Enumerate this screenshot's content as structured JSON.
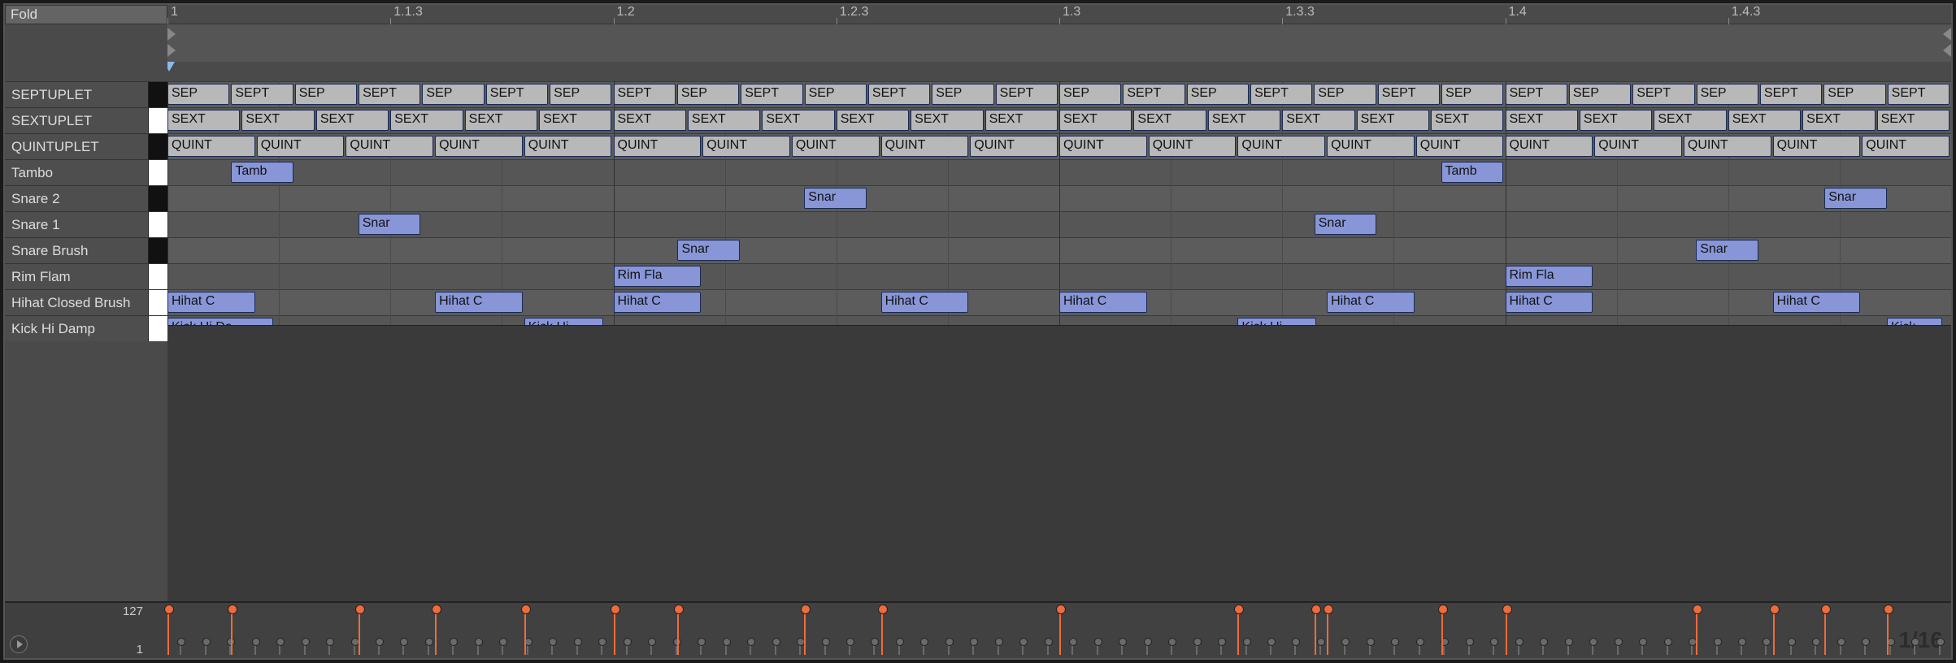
{
  "header": {
    "fold_label": "Fold"
  },
  "ruler": {
    "ticks": [
      {
        "pos": 0.0,
        "label": "1"
      },
      {
        "pos": 0.125,
        "label": "1.1.3"
      },
      {
        "pos": 0.25,
        "label": "1.2"
      },
      {
        "pos": 0.375,
        "label": "1.2.3"
      },
      {
        "pos": 0.5,
        "label": "1.3"
      },
      {
        "pos": 0.625,
        "label": "1.3.3"
      },
      {
        "pos": 0.75,
        "label": "1.4"
      },
      {
        "pos": 0.875,
        "label": "1.4.3"
      }
    ]
  },
  "playhead": {
    "pos": 0.001
  },
  "tracks": [
    {
      "name": "SEPTUPLET",
      "key": "black"
    },
    {
      "name": "SEXTUPLET",
      "key": "white"
    },
    {
      "name": "QUINTUPLET",
      "key": "black"
    },
    {
      "name": "Tambo",
      "key": "white"
    },
    {
      "name": "Snare 2",
      "key": "black"
    },
    {
      "name": "Snare 1",
      "key": "white"
    },
    {
      "name": "Snare Brush",
      "key": "black"
    },
    {
      "name": "Rim Flam",
      "key": "white"
    },
    {
      "name": "Hihat Closed Brush",
      "key": "white"
    },
    {
      "name": "Kick Hi Damp",
      "key": "white"
    }
  ],
  "notes": {
    "sep": {
      "count": 28,
      "label_short": "SEP",
      "label_long": "SEPT",
      "color": "grey"
    },
    "sext": {
      "count": 24,
      "label": "SEXT",
      "color": "grey"
    },
    "quint": {
      "count": 20,
      "label": "QUINT",
      "color": "grey"
    },
    "tambo": [
      {
        "pos": 0.0357,
        "w": 0.0357,
        "label": "Tamb"
      },
      {
        "pos": 0.714,
        "w": 0.0357,
        "label": "Tamb"
      }
    ],
    "snare2": [
      {
        "pos": 0.357,
        "w": 0.0357,
        "label": "Snar"
      },
      {
        "pos": 0.929,
        "w": 0.0357,
        "label": "Snar"
      }
    ],
    "snare1": [
      {
        "pos": 0.107,
        "w": 0.0357,
        "label": "Snar"
      },
      {
        "pos": 0.643,
        "w": 0.0357,
        "label": "Snar"
      }
    ],
    "snarebrush": [
      {
        "pos": 0.286,
        "w": 0.0357,
        "label": "Snar"
      },
      {
        "pos": 0.857,
        "w": 0.0357,
        "label": "Snar"
      }
    ],
    "rimflam": [
      {
        "pos": 0.25,
        "w": 0.05,
        "label": "Rim Fla"
      },
      {
        "pos": 0.75,
        "w": 0.05,
        "label": "Rim Fla"
      }
    ],
    "hihat": [
      {
        "pos": 0.0,
        "w": 0.05,
        "label": "Hihat C"
      },
      {
        "pos": 0.15,
        "w": 0.05,
        "label": "Hihat C"
      },
      {
        "pos": 0.25,
        "w": 0.05,
        "label": "Hihat C"
      },
      {
        "pos": 0.4,
        "w": 0.05,
        "label": "Hihat C"
      },
      {
        "pos": 0.5,
        "w": 0.05,
        "label": "Hihat C"
      },
      {
        "pos": 0.65,
        "w": 0.05,
        "label": "Hihat C"
      },
      {
        "pos": 0.75,
        "w": 0.05,
        "label": "Hihat C"
      },
      {
        "pos": 0.9,
        "w": 0.05,
        "label": "Hihat C"
      }
    ],
    "kick": [
      {
        "pos": 0.0,
        "w": 0.06,
        "label": "Kick Hi Da"
      },
      {
        "pos": 0.2,
        "w": 0.045,
        "label": "Kick Hi"
      },
      {
        "pos": 0.6,
        "w": 0.045,
        "label": "Kick Hi"
      },
      {
        "pos": 0.964,
        "w": 0.032,
        "label": "Kick"
      }
    ]
  },
  "velocity": {
    "max_label": "127",
    "min_label": "1",
    "grid_label": "1/16",
    "hi_positions": [
      0.0,
      0.0357,
      0.107,
      0.15,
      0.2,
      0.25,
      0.286,
      0.357,
      0.4,
      0.5,
      0.6,
      0.643,
      0.65,
      0.714,
      0.75,
      0.857,
      0.9,
      0.929,
      0.964
    ],
    "lo_count": 72
  }
}
